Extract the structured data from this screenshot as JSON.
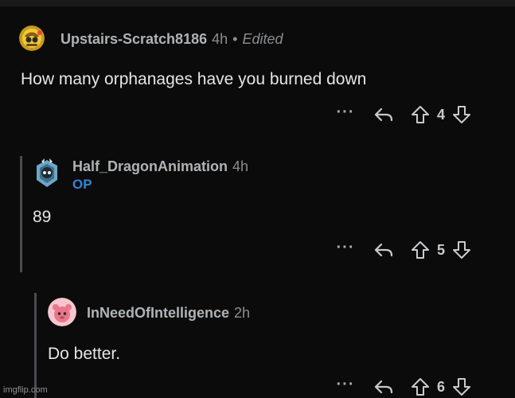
{
  "comments": [
    {
      "username": "Upstairs-Scratch8186",
      "time": "4h",
      "separator": "•",
      "edited": "Edited",
      "body": "How many orphanages have you burned down",
      "more": "···",
      "score": "4",
      "avatar_icon": "snoo-avatar-gold-icon"
    },
    {
      "username": "Half_DragonAnimation",
      "time": "4h",
      "badge": "OP",
      "body": "89",
      "more": "···",
      "score": "5",
      "avatar_icon": "snoo-avatar-armored-icon"
    },
    {
      "username": "InNeedOfIntelligence",
      "time": "2h",
      "body": "Do better.",
      "more": "···",
      "score": "6",
      "avatar_icon": "snoo-avatar-pink-icon"
    }
  ],
  "watermark": "imgflip.com",
  "colors": {
    "background": "#0b0b0b",
    "op_badge": "#2f86d8",
    "thread_line": "#4a4c4f"
  }
}
